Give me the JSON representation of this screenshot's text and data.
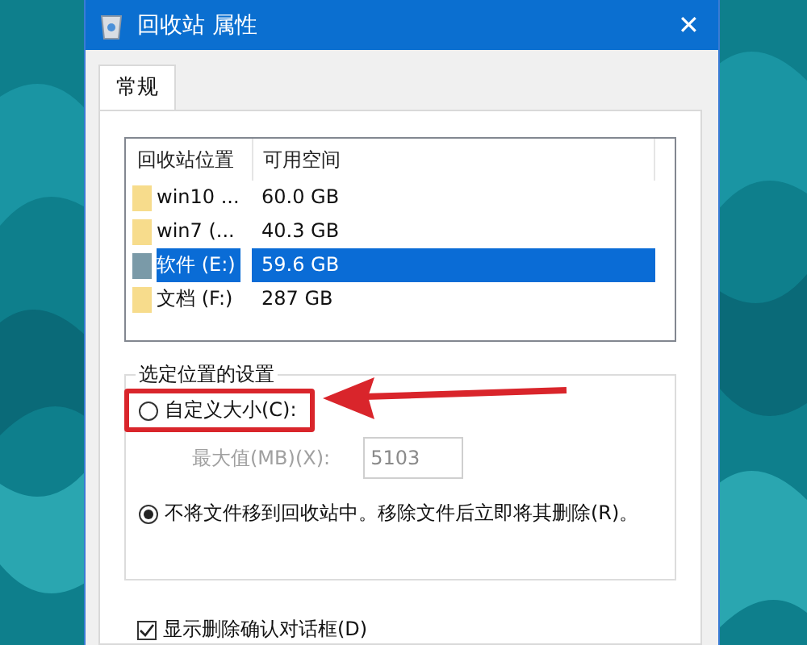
{
  "window": {
    "title": "回收站 属性",
    "close": "✕"
  },
  "tabs": [
    {
      "label": "常规",
      "selected": true
    }
  ],
  "locations": {
    "columns": [
      "回收站位置",
      "可用空间"
    ],
    "rows": [
      {
        "name": "win10 ...",
        "space": "60.0 GB",
        "selected": false
      },
      {
        "name": "win7 (...",
        "space": "40.3 GB",
        "selected": false
      },
      {
        "name": "软件 (E:)",
        "space": "59.6 GB",
        "selected": true
      },
      {
        "name": "文档 (F:)",
        "space": "287 GB",
        "selected": false
      }
    ]
  },
  "settings": {
    "title": "选定位置的设置",
    "custom_size": {
      "label": "自定义大小(C):",
      "selected": false
    },
    "max_size": {
      "label": "最大值(MB)(X):",
      "value": "5103",
      "disabled": true
    },
    "delete_immediately": {
      "label": "不将文件移到回收站中。移除文件后立即将其删除(R)。",
      "selected": true
    }
  },
  "confirm_dialog": {
    "label": "显示删除确认对话框(D)",
    "checked": true
  }
}
